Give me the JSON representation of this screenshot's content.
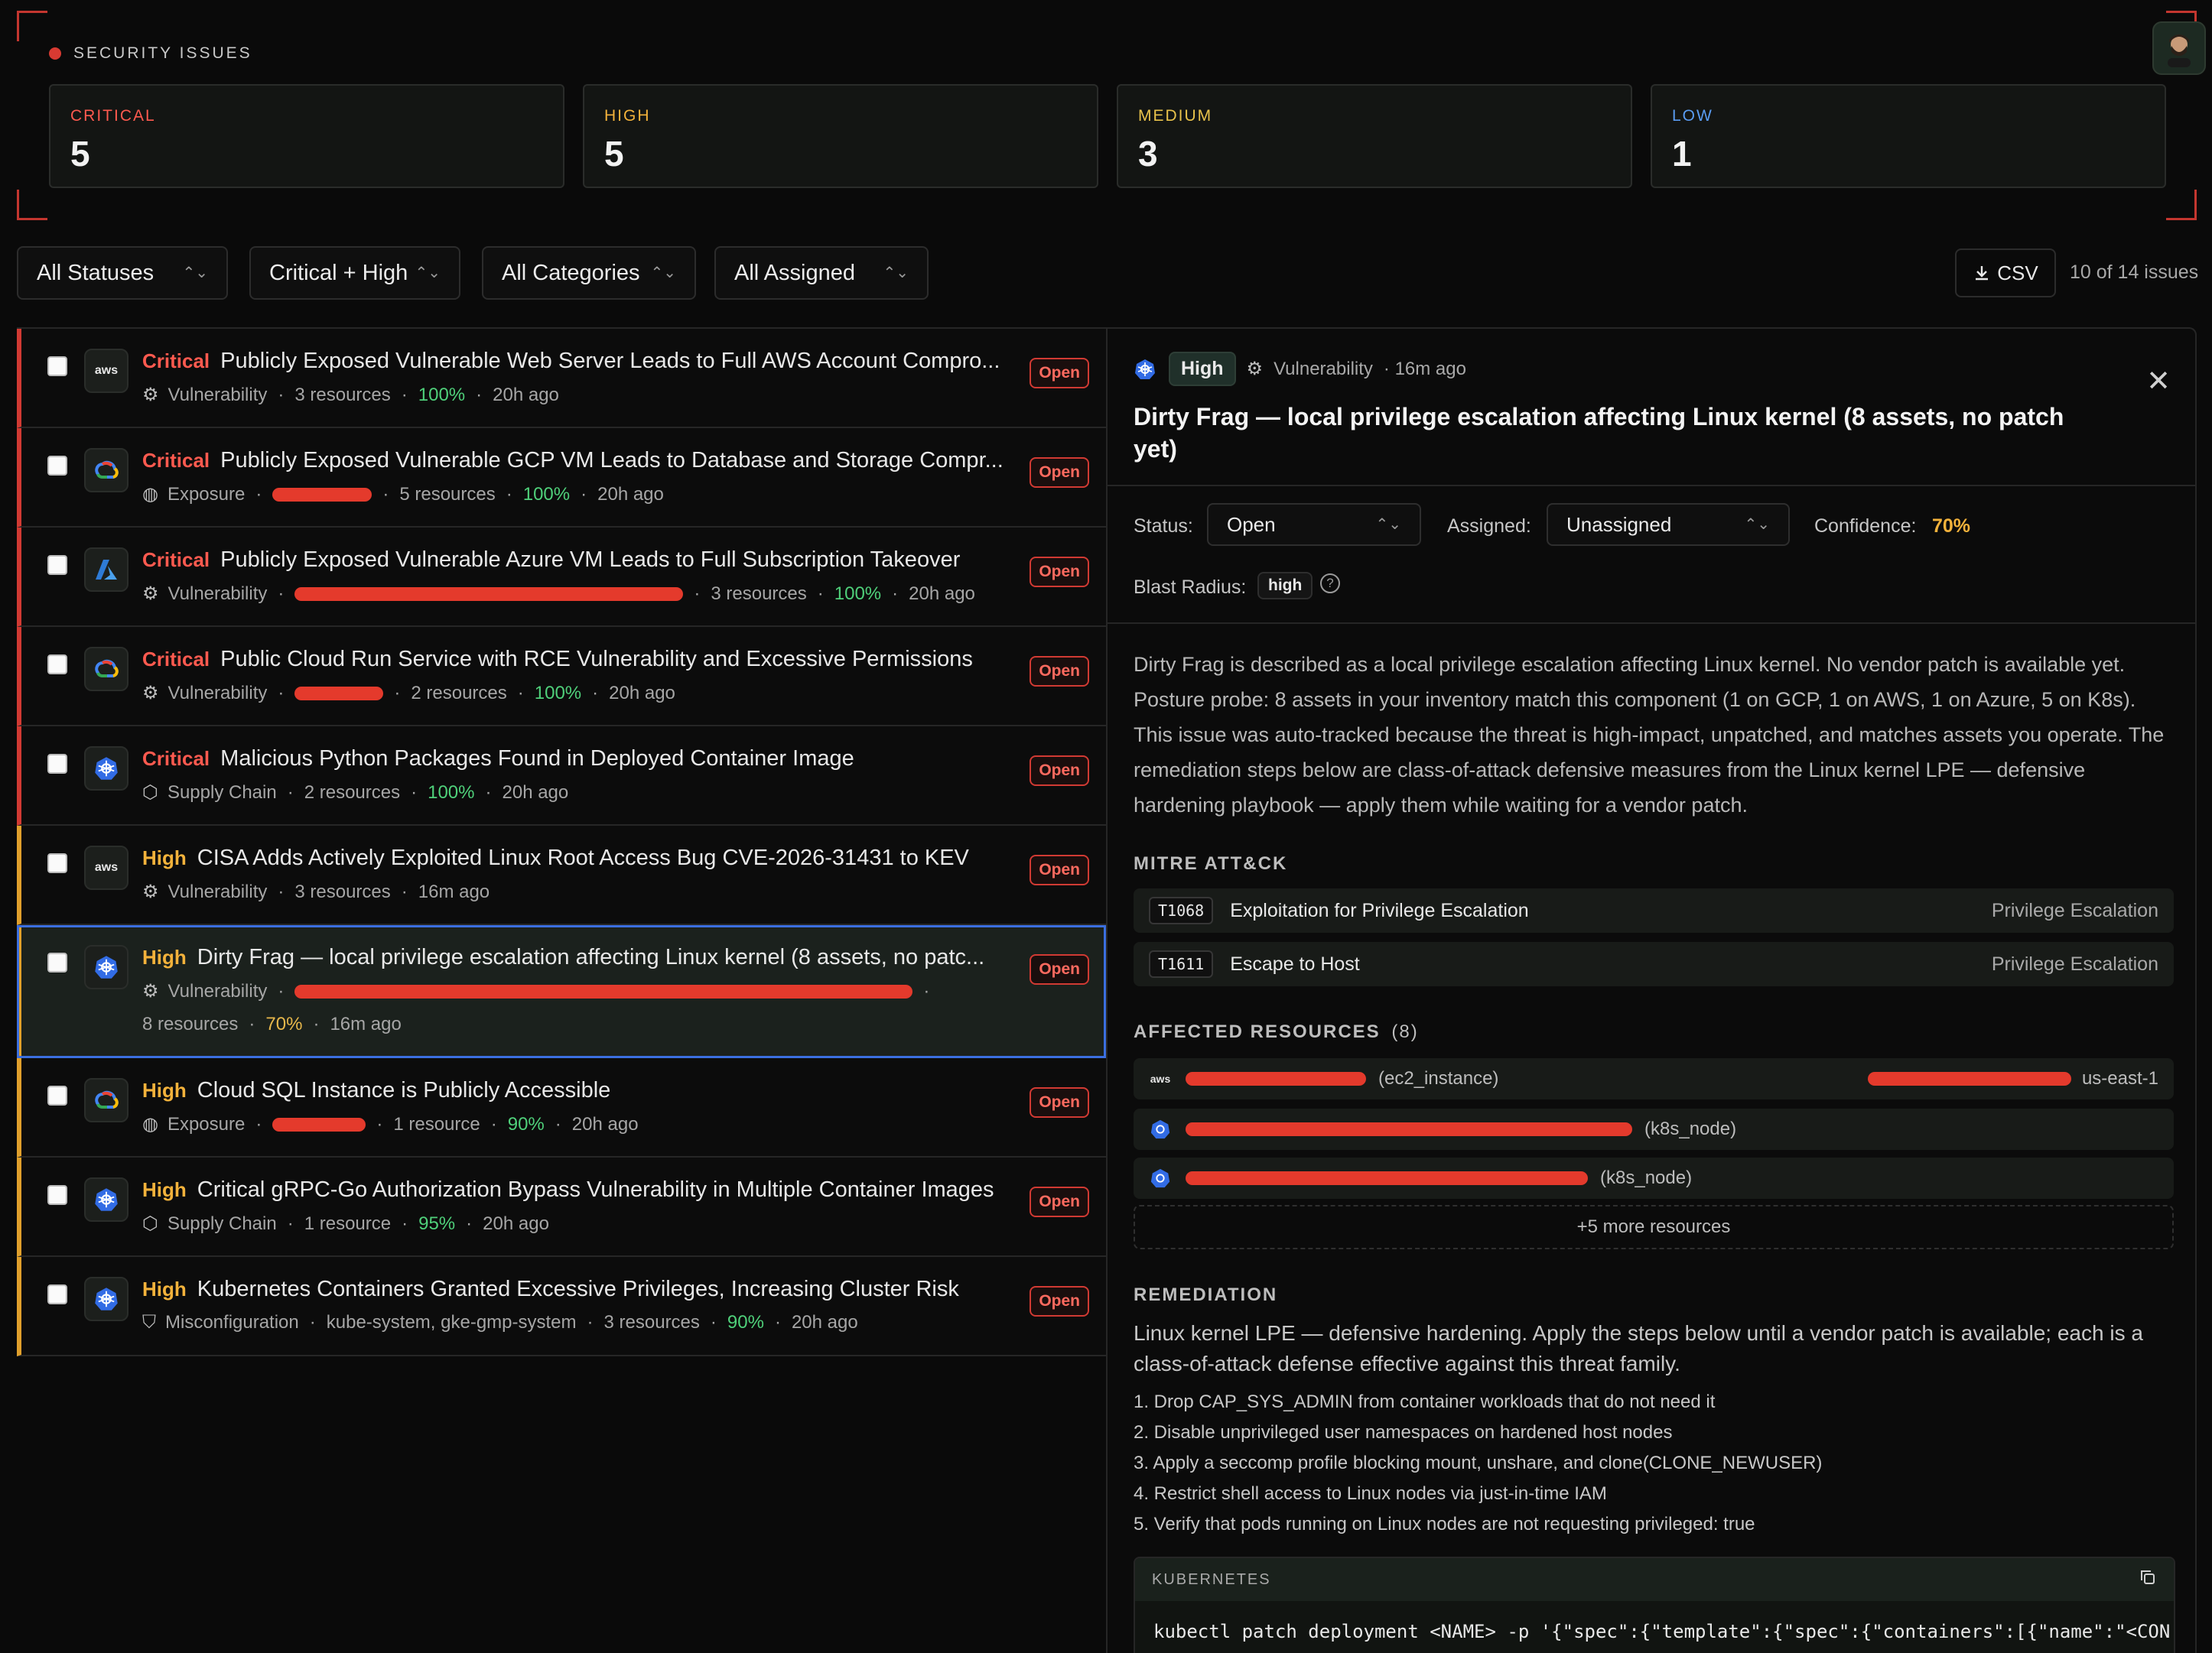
{
  "header": {
    "title": "SECURITY ISSUES"
  },
  "stats": [
    {
      "label": "CRITICAL",
      "value": "5",
      "color": "#ff5a4f"
    },
    {
      "label": "HIGH",
      "value": "5",
      "color": "#f3b23b"
    },
    {
      "label": "MEDIUM",
      "value": "3",
      "color": "#e8c24b"
    },
    {
      "label": "LOW",
      "value": "1",
      "color": "#5a9cf2"
    }
  ],
  "filters": {
    "status": "All Statuses",
    "severity": "Critical + High",
    "category": "All Categories",
    "assigned": "All Assigned",
    "csv": "CSV",
    "count": "10 of 14 issues"
  },
  "issues": [
    {
      "sev": "Critical",
      "title": "Publicly Exposed Vulnerable Web Server Leads to Full AWS Account Compro...",
      "provider": "aws",
      "category": "Vulnerability",
      "resources": "3 resources",
      "confidence": "100%",
      "time": "20h ago",
      "status": "Open"
    },
    {
      "sev": "Critical",
      "title": "Publicly Exposed Vulnerable GCP VM Leads to Database and Storage Compr...",
      "provider": "gcp",
      "category": "Exposure",
      "resources": "5 resources",
      "confidence": "100%",
      "time": "20h ago",
      "status": "Open"
    },
    {
      "sev": "Critical",
      "title": "Publicly Exposed Vulnerable Azure VM Leads to Full Subscription Takeover",
      "provider": "azure",
      "category": "Vulnerability",
      "resources": "3 resources",
      "confidence": "100%",
      "time": "20h ago",
      "status": "Open"
    },
    {
      "sev": "Critical",
      "title": "Public Cloud Run Service with RCE Vulnerability and Excessive Permissions",
      "provider": "gcp",
      "category": "Vulnerability",
      "resources": "2 resources",
      "confidence": "100%",
      "time": "20h ago",
      "status": "Open"
    },
    {
      "sev": "Critical",
      "title": "Malicious Python Packages Found in Deployed Container Image",
      "provider": "k8s",
      "category": "Supply Chain",
      "resources": "2 resources",
      "confidence": "100%",
      "time": "20h ago",
      "status": "Open"
    },
    {
      "sev": "High",
      "title": "CISA Adds Actively Exploited Linux Root Access Bug CVE-2026-31431 to KEV",
      "provider": "aws",
      "category": "Vulnerability",
      "resources": "3 resources",
      "confidence": "",
      "time": "16m ago",
      "status": "Open"
    },
    {
      "sev": "High",
      "title": "Dirty Frag — local privilege escalation affecting Linux kernel (8 assets, no patc...",
      "provider": "k8s",
      "category": "Vulnerability",
      "resources": "8 resources",
      "confidence": "70%",
      "time": "16m ago",
      "status": "Open"
    },
    {
      "sev": "High",
      "title": "Cloud SQL Instance is Publicly Accessible",
      "provider": "gcp",
      "category": "Exposure",
      "resources": "1 resource",
      "confidence": "90%",
      "time": "20h ago",
      "status": "Open"
    },
    {
      "sev": "High",
      "title": "Critical gRPC-Go Authorization Bypass Vulnerability in Multiple Container Images",
      "provider": "k8s",
      "category": "Supply Chain",
      "resources": "1 resource",
      "confidence": "95%",
      "time": "20h ago",
      "status": "Open"
    },
    {
      "sev": "High",
      "title": "Kubernetes Containers Granted Excessive Privileges, Increasing Cluster Risk",
      "provider": "k8s",
      "category": "Misconfiguration",
      "namespaces": "kube-system, gke-gmp-system",
      "resources": "3 resources",
      "confidence": "90%",
      "time": "20h ago",
      "status": "Open"
    }
  ],
  "detail": {
    "severity": "High",
    "category": "Vulnerability",
    "time": "· 16m ago",
    "title": "Dirty Frag — local privilege escalation affecting Linux kernel (8 assets, no patch yet)",
    "status_label": "Status:",
    "status_value": "Open",
    "assigned_label": "Assigned:",
    "assigned_value": "Unassigned",
    "confidence_label": "Confidence:",
    "confidence_value": "70%",
    "blast_label": "Blast Radius:",
    "blast_value": "high",
    "description": "Dirty Frag is described as a local privilege escalation affecting Linux kernel. No vendor patch is available yet. Posture probe: 8 assets in your inventory match this component (1 on GCP, 1 on AWS, 1 on Azure, 5 on K8s). This issue was auto-tracked because the threat is high-impact, unpatched, and matches assets you operate. The remediation steps below are class-of-attack defensive measures from the Linux kernel LPE — defensive hardening playbook — apply them while waiting for a vendor patch.",
    "mitre_heading": "MITRE ATT&CK",
    "mitre": [
      {
        "id": "T1068",
        "name": "Exploitation for Privilege Escalation",
        "tactic": "Privilege Escalation"
      },
      {
        "id": "T1611",
        "name": "Escape to Host",
        "tactic": "Privilege Escalation"
      }
    ],
    "resources_heading": "AFFECTED RESOURCES",
    "resources_count": "(8)",
    "resources": [
      {
        "type": "(ec2_instance)",
        "region": "us-east-1"
      },
      {
        "type": "(k8s_node)"
      },
      {
        "type": "(k8s_node)"
      }
    ],
    "more": "+5 more resources",
    "remediation_heading": "REMEDIATION",
    "remediation_intro": "Linux kernel LPE — defensive hardening. Apply the steps below until a vendor patch is available; each is a class-of-attack defense effective against this threat family.",
    "steps": [
      "1. Drop CAP_SYS_ADMIN from container workloads that do not need it",
      "2. Disable unprivileged user namespaces on hardened host nodes",
      "3. Apply a seccomp profile blocking mount, unshare, and clone(CLONE_NEWUSER)",
      "4. Restrict shell access to Linux nodes via just-in-time IAM",
      "5. Verify that pods running on Linux nodes are not requesting privileged: true"
    ],
    "code_label": "KUBERNETES",
    "code": "kubectl patch deployment <NAME> -p '{\"spec\":{\"template\":{\"spec\":{\"containers\":[{\"name\":\"<CON"
  }
}
